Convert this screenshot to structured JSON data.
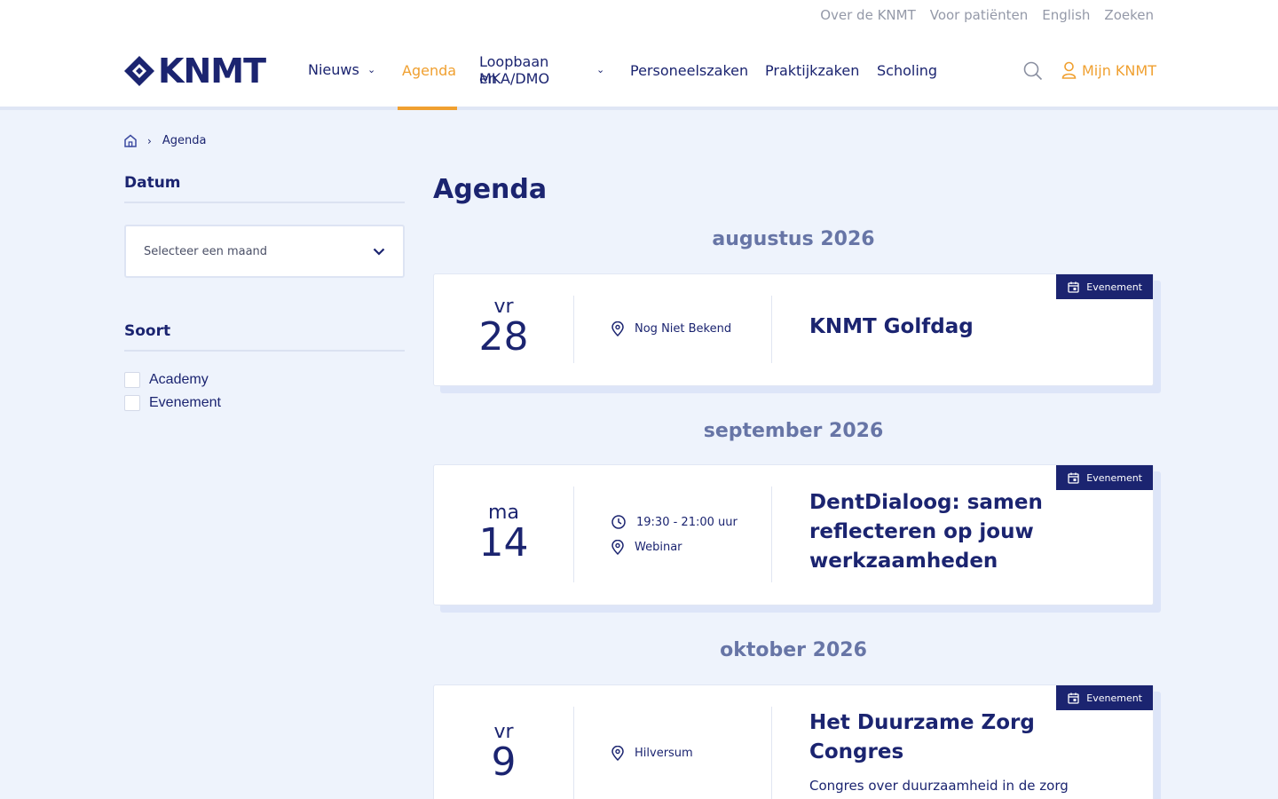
{
  "top_links": [
    "Over de KNMT",
    "Voor patiënten",
    "English",
    "Zoeken"
  ],
  "logo": {
    "text": "KNMT"
  },
  "nav": {
    "nieuws": "Nieuws",
    "agenda": "Agenda",
    "loopbaan_line1": "Loopbaan en",
    "loopbaan_line2": "MKA/DMO",
    "personeelszaken": "Personeelszaken",
    "praktijkzaken": "Praktijkzaken",
    "scholing": "Scholing",
    "mijn": "Mijn KNMT"
  },
  "breadcrumb": {
    "current": "Agenda"
  },
  "sidebar": {
    "datum_heading": "Datum",
    "select_placeholder": "Selecteer een maand",
    "soort_heading": "Soort",
    "options": [
      "Academy",
      "Evenement"
    ]
  },
  "page_title": "Agenda",
  "months": [
    "augustus 2026",
    "september 2026",
    "oktober 2026"
  ],
  "events": [
    {
      "weekday": "vr",
      "day": "28",
      "location": "Nog Niet Bekend",
      "title": "KNMT Golfdag",
      "badge": "Evenement"
    },
    {
      "weekday": "ma",
      "day": "14",
      "time": "19:30 - 21:00 uur",
      "location": "Webinar",
      "title_lines": [
        "DentDialoog: samen",
        "reflecteren op jouw",
        "werkzaamheden"
      ],
      "badge": "Evenement"
    },
    {
      "weekday": "vr",
      "day": "9",
      "location": "Hilversum",
      "title_lines": [
        "Het Duurzame Zorg",
        "Congres"
      ],
      "subtitle": "Congres over duurzaamheid in de zorg",
      "badge": "Evenement"
    }
  ],
  "colors": {
    "navy": "#1b2470",
    "orange": "#f0a030",
    "background": "#eef3fc",
    "month": "#6775a6"
  }
}
